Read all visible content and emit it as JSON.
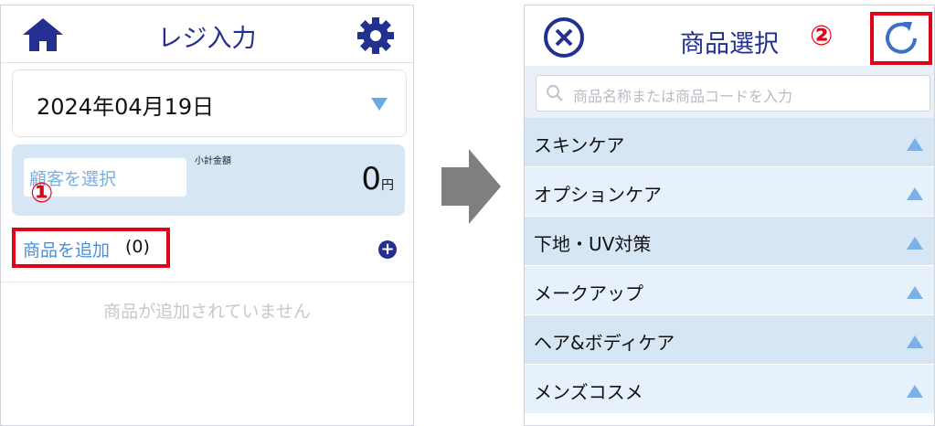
{
  "left": {
    "title": "レジ入力",
    "date": "2024年04月19日",
    "customer_placeholder": "顧客を選択",
    "subtotal_label": "小計金額",
    "subtotal_value": "0",
    "subtotal_unit": "円",
    "step_marker": "①",
    "add_label": "商品を追加",
    "add_count": "(0)",
    "plus_symbol": "+",
    "empty_message": "商品が追加されていません"
  },
  "right": {
    "title": "商品選択",
    "step_marker": "②",
    "search_placeholder": "商品名称または商品コードを入力",
    "categories": [
      {
        "label": "スキンケア"
      },
      {
        "label": "オプションケア"
      },
      {
        "label": "下地・UV対策"
      },
      {
        "label": "メークアップ"
      },
      {
        "label": "ヘア&ボディケア"
      },
      {
        "label": "メンズコスメ"
      }
    ]
  },
  "icons": [
    "home-icon",
    "gear-icon",
    "chevron-down-icon",
    "plus-icon",
    "arrow-right-icon",
    "close-icon",
    "refresh-icon",
    "search-icon",
    "chevron-up-icon"
  ],
  "colors": {
    "brand": "#23308f",
    "accent": "#4a90d9",
    "highlight": "#e3001b",
    "row_dark": "#d6e6f4",
    "row_light": "#e6f1fb"
  }
}
